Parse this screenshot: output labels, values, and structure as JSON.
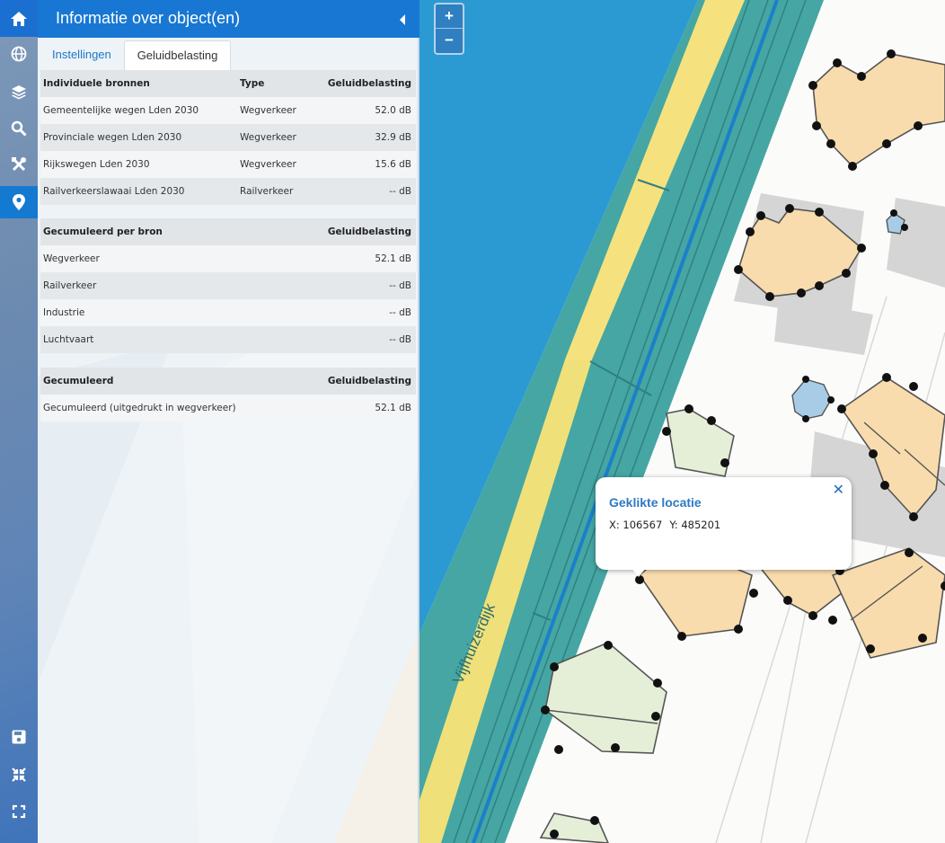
{
  "panel": {
    "title": "Informatie over object(en)",
    "tabs": [
      "Instellingen",
      "Geluidbelasting"
    ],
    "individual": {
      "headers": [
        "Individuele bronnen",
        "Type",
        "Geluidbelasting"
      ],
      "rows": [
        [
          "Gemeentelijke wegen Lden 2030",
          "Wegverkeer",
          "52.0 dB"
        ],
        [
          "Provinciale wegen Lden 2030",
          "Wegverkeer",
          "32.9 dB"
        ],
        [
          "Rijkswegen Lden 2030",
          "Wegverkeer",
          "15.6 dB"
        ],
        [
          "Railverkeerslawaai Lden 2030",
          "Railverkeer",
          "-- dB"
        ]
      ]
    },
    "per_source": {
      "headers": [
        "Gecumuleerd per bron",
        "Geluidbelasting"
      ],
      "rows": [
        [
          "Wegverkeer",
          "52.1 dB"
        ],
        [
          "Railverkeer",
          "-- dB"
        ],
        [
          "Industrie",
          "-- dB"
        ],
        [
          "Luchtvaart",
          "-- dB"
        ]
      ]
    },
    "cumulative": {
      "headers": [
        "Gecumuleerd",
        "Geluidbelasting"
      ],
      "rows": [
        [
          "Gecumuleerd (uitgedrukt in wegverkeer)",
          "52.1 dB"
        ]
      ]
    }
  },
  "rail": {
    "top_icons": [
      "home-icon",
      "globe-icon",
      "layers-icon",
      "search-icon",
      "tools-icon",
      "map-marker-icon"
    ],
    "bottom_icons": [
      "save-icon",
      "compress-icon",
      "fullscreen-icon"
    ],
    "active": "map-marker-icon"
  },
  "map": {
    "zoom_in": "+",
    "zoom_out": "−",
    "street_label": "Vijfhuizerdijk",
    "popup": {
      "title": "Geklikte locatie",
      "x": "X: 106567",
      "y": "Y: 485201",
      "close": "✕"
    }
  },
  "colors": {
    "accent": "#1877d3",
    "water": "#2b9ad2",
    "building": "#f9dcad",
    "building_green": "#e5efd8"
  }
}
